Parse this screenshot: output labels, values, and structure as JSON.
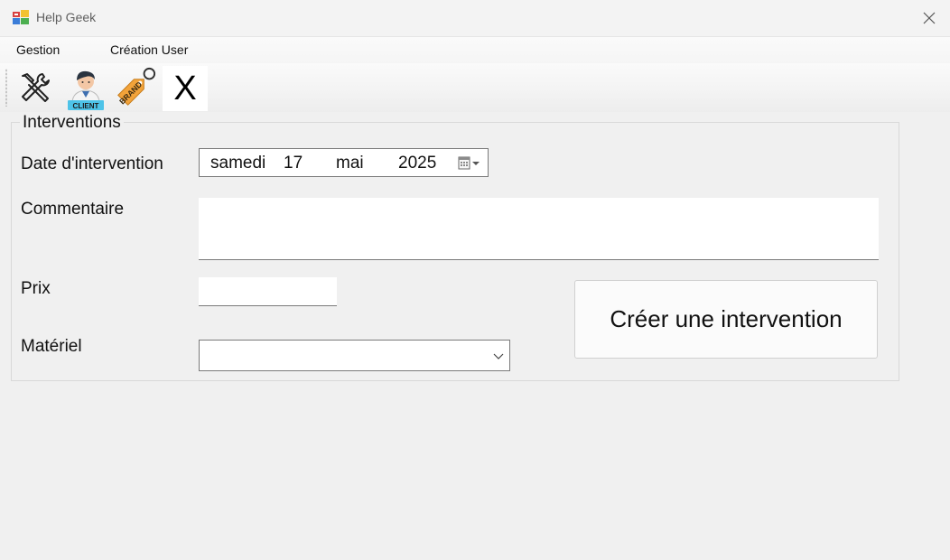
{
  "window": {
    "title": "Help Geek"
  },
  "menu": {
    "items": [
      {
        "label": "Gestion"
      },
      {
        "label": "Création User"
      }
    ]
  },
  "toolbar": {
    "tools": [
      {
        "icon": "tools-icon"
      },
      {
        "icon": "client-icon",
        "badge": "CLIENT"
      },
      {
        "icon": "brand-tag-icon",
        "badge": "BRAND"
      },
      {
        "icon": "x-icon",
        "glyph": "X"
      }
    ]
  },
  "form": {
    "group_title": "Interventions",
    "date": {
      "label": "Date d'intervention",
      "day_name": "samedi",
      "day": "17",
      "month": "mai",
      "year": "2025"
    },
    "comment": {
      "label": "Commentaire",
      "value": ""
    },
    "price": {
      "label": "Prix",
      "value": ""
    },
    "material": {
      "label": "Matériel",
      "selected": ""
    },
    "submit_label": "Créer une intervention"
  },
  "colors": {
    "accent_orange": "#f2a33a",
    "badge_blue": "#4ec3e8",
    "border": "#7a7a7a"
  }
}
